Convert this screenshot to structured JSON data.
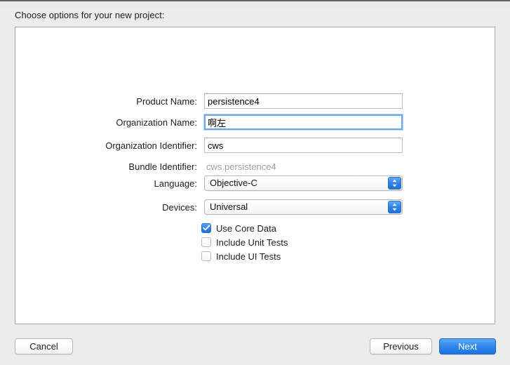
{
  "window": {
    "header_prompt": "Choose options for your new project:"
  },
  "form": {
    "rows": [
      {
        "label": "Product Name:",
        "value": "persistence4",
        "type": "text",
        "focused": false
      },
      {
        "label": "Organization Name:",
        "value": "啊左",
        "type": "text",
        "focused": true
      },
      {
        "label": "Organization Identifier:",
        "value": "cws",
        "type": "text",
        "focused": false
      },
      {
        "label": "Bundle Identifier:",
        "value": "cws.persistence4",
        "type": "static",
        "focused": false
      },
      {
        "label": "Language:",
        "value": "Objective-C",
        "type": "popup",
        "focused": false
      },
      {
        "label": "Devices:",
        "value": "Universal",
        "type": "popup",
        "focused": false
      }
    ]
  },
  "checkboxes": [
    {
      "label": "Use Core Data",
      "checked": true
    },
    {
      "label": "Include Unit Tests",
      "checked": false
    },
    {
      "label": "Include UI Tests",
      "checked": false
    }
  ],
  "buttons": {
    "cancel": "Cancel",
    "previous": "Previous",
    "next": "Next"
  },
  "colors": {
    "accent_blue": "#2b80e9",
    "focus_ring": "#6aa9e9",
    "window_bg": "#ececec",
    "content_bg": "#ffffff",
    "disabled_text": "#a0a0a0"
  },
  "icons": {
    "popup_arrows": "chevron-up-down-icon",
    "checkmark": "checkmark-icon"
  }
}
